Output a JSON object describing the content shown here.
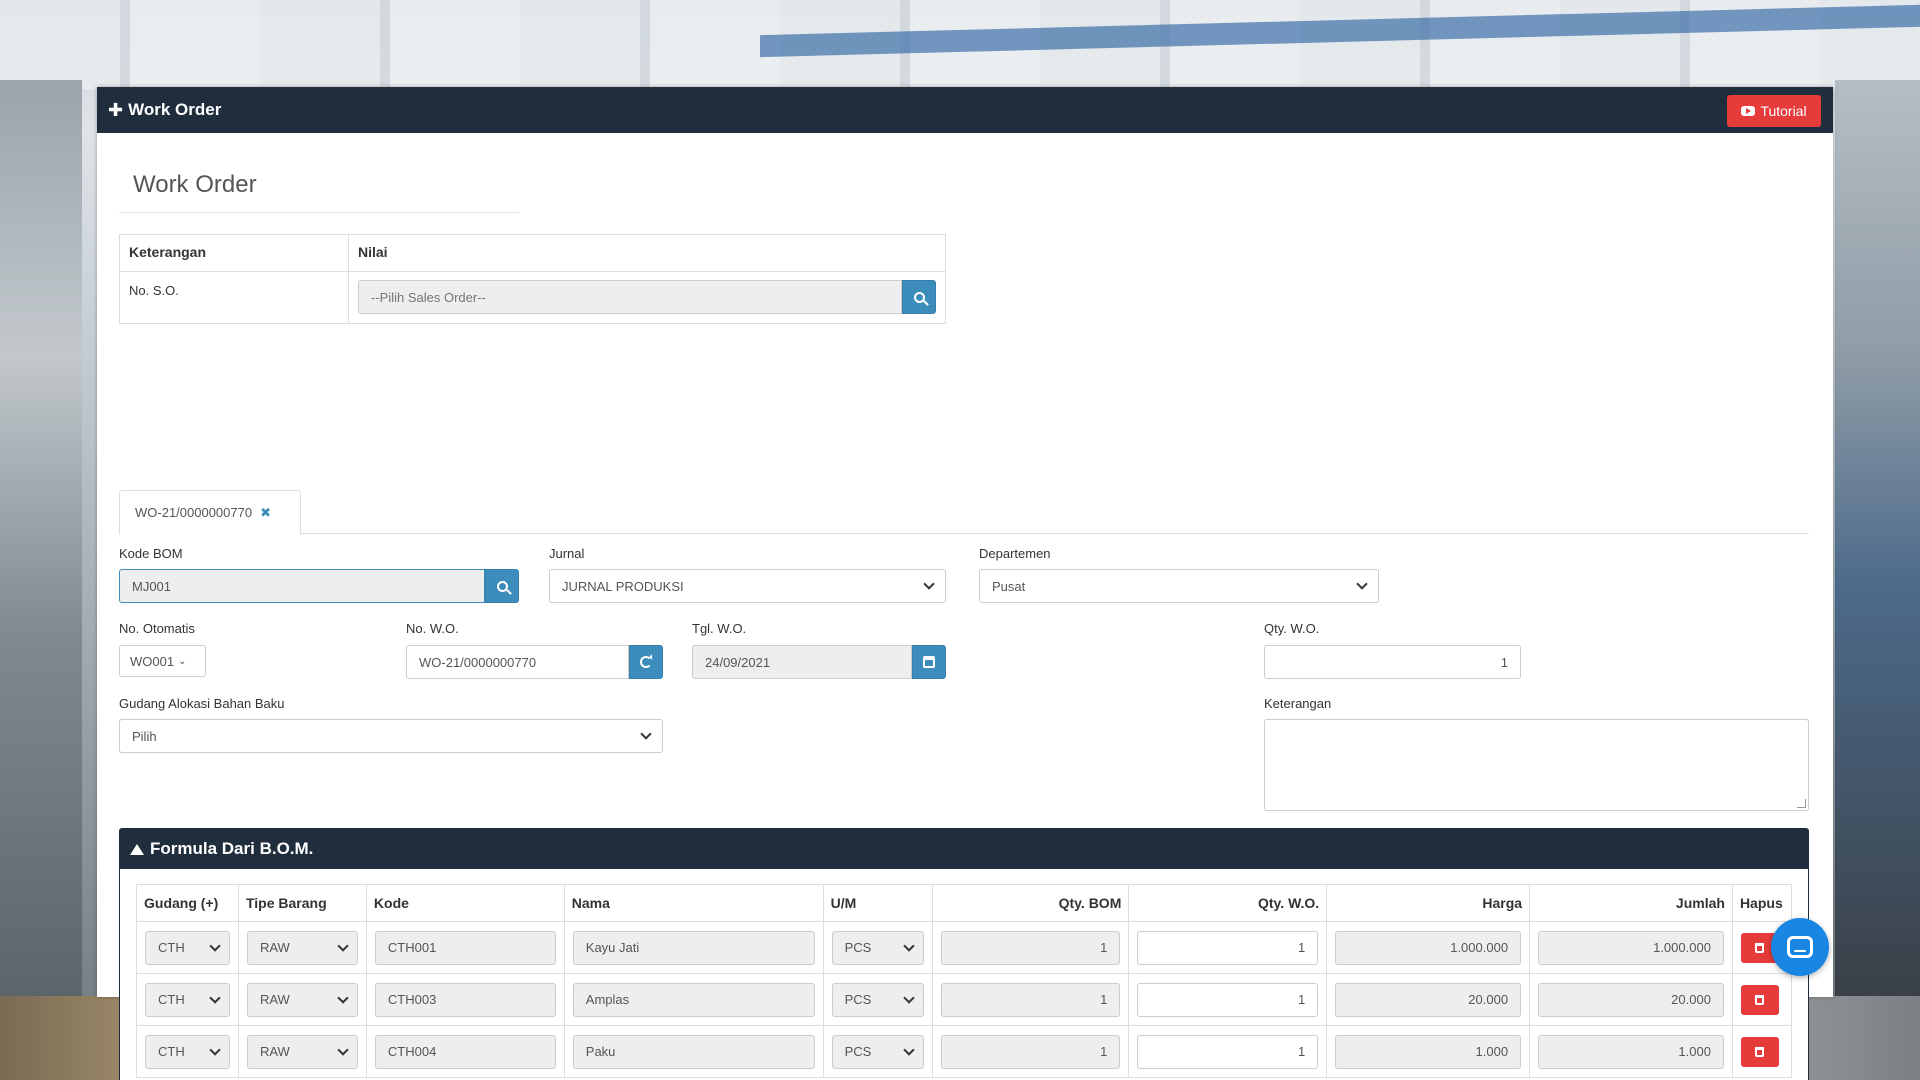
{
  "header": {
    "title": "Work Order",
    "tutorial_label": "Tutorial"
  },
  "page_title": "Work Order",
  "so_table": {
    "col_keterangan": "Keterangan",
    "col_nilai": "Nilai",
    "row_label": "No. S.O.",
    "placeholder": "--Pilih Sales Order--"
  },
  "tab": {
    "label": "WO-21/0000000770",
    "close": "✖"
  },
  "form": {
    "kode_bom": {
      "label": "Kode BOM",
      "value": "MJ001"
    },
    "jurnal": {
      "label": "Jurnal",
      "value": "JURNAL PRODUKSI"
    },
    "departemen": {
      "label": "Departemen",
      "value": "Pusat"
    },
    "no_otomatis": {
      "label": "No. Otomatis",
      "value": "WO001"
    },
    "no_wo": {
      "label": "No. W.O.",
      "value": "WO-21/0000000770"
    },
    "tgl_wo": {
      "label": "Tgl. W.O.",
      "value": "24/09/2021"
    },
    "qty_wo": {
      "label": "Qty. W.O.",
      "value": "1"
    },
    "gudang_alokasi": {
      "label": "Gudang Alokasi Bahan Baku",
      "value": "Pilih"
    },
    "keterangan": {
      "label": "Keterangan",
      "value": ""
    }
  },
  "formula": {
    "title": "Formula Dari B.O.M.",
    "columns": [
      "Gudang (+)",
      "Tipe Barang",
      "Kode",
      "Nama",
      "U/M",
      "Qty. BOM",
      "Qty. W.O.",
      "Harga",
      "Jumlah",
      "Hapus"
    ],
    "rows": [
      {
        "gudang": "CTH",
        "tipe": "RAW",
        "kode": "CTH001",
        "nama": "Kayu Jati",
        "um": "PCS",
        "qty_bom": "1",
        "qty_wo": "1",
        "harga": "1.000.000",
        "jumlah": "1.000.000"
      },
      {
        "gudang": "CTH",
        "tipe": "RAW",
        "kode": "CTH003",
        "nama": "Amplas",
        "um": "PCS",
        "qty_bom": "1",
        "qty_wo": "1",
        "harga": "20.000",
        "jumlah": "20.000"
      },
      {
        "gudang": "CTH",
        "tipe": "RAW",
        "kode": "CTH004",
        "nama": "Paku",
        "um": "PCS",
        "qty_bom": "1",
        "qty_wo": "1",
        "harga": "1.000",
        "jumlah": "1.000"
      }
    ]
  },
  "colors": {
    "navy": "#1f2d3d",
    "accent": "#3c8dbc",
    "danger": "#e53b3b",
    "chat": "#1a86e4"
  }
}
